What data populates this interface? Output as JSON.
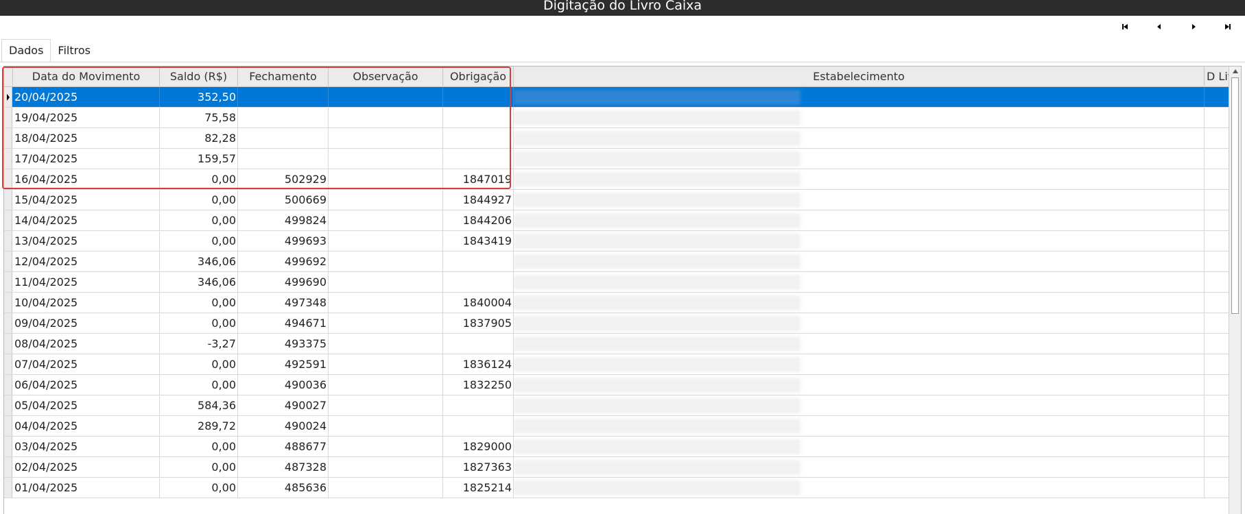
{
  "window": {
    "title": "Digitação do Livro Caixa"
  },
  "navigation": {
    "first": "first-record",
    "prev": "previous-record",
    "next": "next-record",
    "last": "last-record"
  },
  "tabs": [
    {
      "label": "Dados",
      "active": true
    },
    {
      "label": "Filtros",
      "active": false
    }
  ],
  "grid": {
    "columns": {
      "data": "Data do Movimento",
      "saldo": "Saldo (R$)",
      "fechamento": "Fechamento",
      "observacao": "Observação",
      "obrigacao": "Obrigação",
      "estabelecimento": "Estabelecimento",
      "livro": "D Livr"
    },
    "rows": [
      {
        "data": "20/04/2025",
        "saldo": "352,50",
        "fechamento": "",
        "observacao": "",
        "obrigacao": "",
        "selected": true
      },
      {
        "data": "19/04/2025",
        "saldo": "75,58",
        "fechamento": "",
        "observacao": "",
        "obrigacao": ""
      },
      {
        "data": "18/04/2025",
        "saldo": "82,28",
        "fechamento": "",
        "observacao": "",
        "obrigacao": ""
      },
      {
        "data": "17/04/2025",
        "saldo": "159,57",
        "fechamento": "",
        "observacao": "",
        "obrigacao": ""
      },
      {
        "data": "16/04/2025",
        "saldo": "0,00",
        "fechamento": "502929",
        "observacao": "",
        "obrigacao": "1847019"
      },
      {
        "data": "15/04/2025",
        "saldo": "0,00",
        "fechamento": "500669",
        "observacao": "",
        "obrigacao": "1844927"
      },
      {
        "data": "14/04/2025",
        "saldo": "0,00",
        "fechamento": "499824",
        "observacao": "",
        "obrigacao": "1844206"
      },
      {
        "data": "13/04/2025",
        "saldo": "0,00",
        "fechamento": "499693",
        "observacao": "",
        "obrigacao": "1843419"
      },
      {
        "data": "12/04/2025",
        "saldo": "346,06",
        "fechamento": "499692",
        "observacao": "",
        "obrigacao": ""
      },
      {
        "data": "11/04/2025",
        "saldo": "346,06",
        "fechamento": "499690",
        "observacao": "",
        "obrigacao": ""
      },
      {
        "data": "10/04/2025",
        "saldo": "0,00",
        "fechamento": "497348",
        "observacao": "",
        "obrigacao": "1840004"
      },
      {
        "data": "09/04/2025",
        "saldo": "0,00",
        "fechamento": "494671",
        "observacao": "",
        "obrigacao": "1837905"
      },
      {
        "data": "08/04/2025",
        "saldo": "-3,27",
        "fechamento": "493375",
        "observacao": "",
        "obrigacao": ""
      },
      {
        "data": "07/04/2025",
        "saldo": "0,00",
        "fechamento": "492591",
        "observacao": "",
        "obrigacao": "1836124"
      },
      {
        "data": "06/04/2025",
        "saldo": "0,00",
        "fechamento": "490036",
        "observacao": "",
        "obrigacao": "1832250"
      },
      {
        "data": "05/04/2025",
        "saldo": "584,36",
        "fechamento": "490027",
        "observacao": "",
        "obrigacao": ""
      },
      {
        "data": "04/04/2025",
        "saldo": "289,72",
        "fechamento": "490024",
        "observacao": "",
        "obrigacao": ""
      },
      {
        "data": "03/04/2025",
        "saldo": "0,00",
        "fechamento": "488677",
        "observacao": "",
        "obrigacao": "1829000"
      },
      {
        "data": "02/04/2025",
        "saldo": "0,00",
        "fechamento": "487328",
        "observacao": "",
        "obrigacao": "1827363"
      },
      {
        "data": "01/04/2025",
        "saldo": "0,00",
        "fechamento": "485636",
        "observacao": "",
        "obrigacao": "1825214"
      }
    ]
  },
  "colors": {
    "selection": "#0078d7",
    "highlight_border": "#d93a3a",
    "titlebar": "#2d2d2d"
  }
}
